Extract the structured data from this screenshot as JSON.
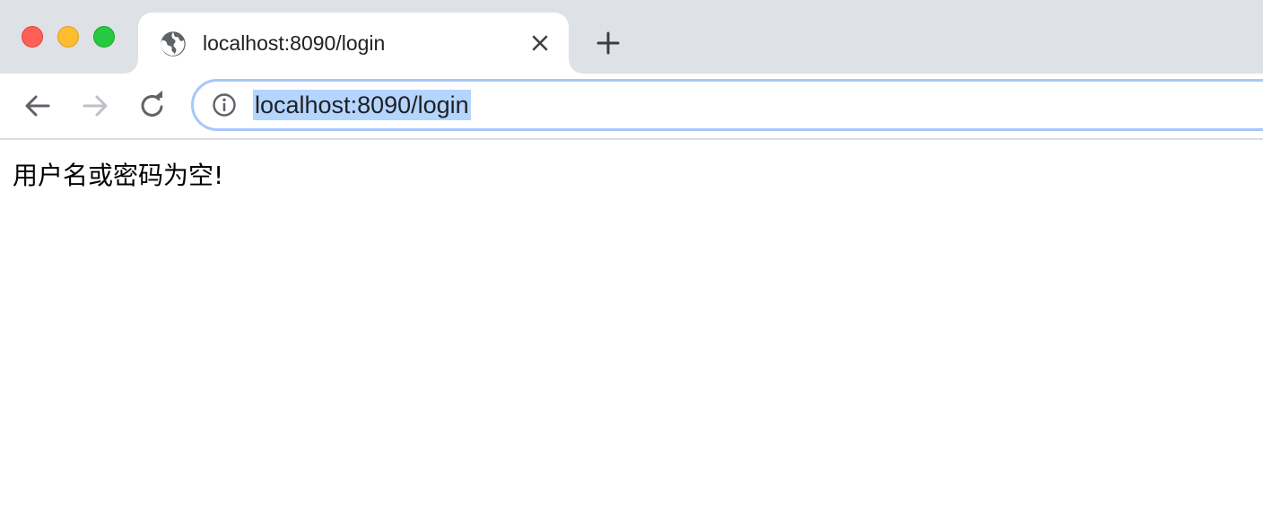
{
  "browser": {
    "window_controls": {
      "close_color": "#ff5f57",
      "minimize_color": "#febc2e",
      "maximize_color": "#28c840"
    },
    "tab": {
      "title": "localhost:8090/login",
      "favicon": "globe-icon",
      "close_icon": "close-icon"
    },
    "new_tab_icon": "plus-icon",
    "toolbar": {
      "back_icon": "arrow-left-icon",
      "forward_icon": "arrow-right-icon",
      "reload_icon": "reload-icon",
      "site_info_icon": "info-icon",
      "url": "localhost:8090/login"
    }
  },
  "page": {
    "message": "用户名或密码为空!"
  }
}
